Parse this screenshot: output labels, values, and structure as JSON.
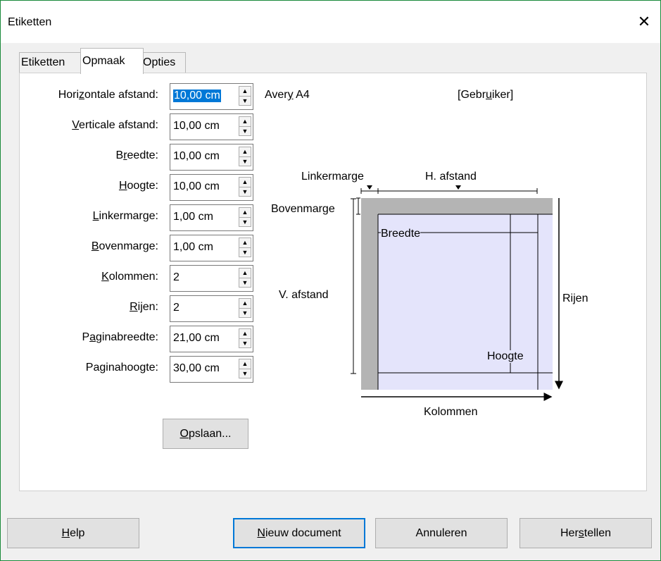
{
  "window": {
    "title": "Etiketten",
    "close_glyph": "✕"
  },
  "tabs": [
    "Etiketten",
    "Opmaak",
    "Opties"
  ],
  "fields": [
    {
      "pre": "Hori",
      "ul": "z",
      "post": "ontale afstand:",
      "value": "10,00 cm",
      "selected": true
    },
    {
      "pre": "",
      "ul": "V",
      "post": "erticale afstand:",
      "value": "10,00 cm"
    },
    {
      "pre": "B",
      "ul": "r",
      "post": "eedte:",
      "value": "10,00 cm"
    },
    {
      "pre": "",
      "ul": "H",
      "post": "oogte:",
      "value": "10,00 cm"
    },
    {
      "pre": "",
      "ul": "L",
      "post": "inkermarge:",
      "value": "1,00 cm"
    },
    {
      "pre": "",
      "ul": "B",
      "post": "ovenmarge:",
      "value": "1,00 cm"
    },
    {
      "pre": "",
      "ul": "K",
      "post": "olommen:",
      "value": "2"
    },
    {
      "pre": "",
      "ul": "R",
      "post": "ijen:",
      "value": "2"
    },
    {
      "pre": "P",
      "ul": "a",
      "post": "ginabreedte:",
      "value": "21,00 cm"
    },
    {
      "pre": "Pa",
      "ul": "g",
      "post": "inahoogte:",
      "value": "30,00 cm"
    }
  ],
  "save_button": {
    "pre": "",
    "ul": "O",
    "post": "pslaan..."
  },
  "brand": {
    "pre": "Aver",
    "ul": "y",
    "post": " A4"
  },
  "type": {
    "pre": "[Gebr",
    "ul": "u",
    "post": "iker]"
  },
  "diagram": {
    "linkermarge": "Linkermarge",
    "h_afstand": "H. afstand",
    "bovenmarge": "Bovenmarge",
    "breedte": "Breedte",
    "v_afstand": "V. afstand",
    "rijen": "Rijen",
    "hoogte": "Hoogte",
    "kolommen": "Kolommen"
  },
  "buttons": {
    "help": {
      "pre": "",
      "ul": "H",
      "post": "elp"
    },
    "new_doc": {
      "pre": "",
      "ul": "N",
      "post": "ieuw document"
    },
    "cancel": {
      "pre": "Annuleren",
      "ul": "",
      "post": ""
    },
    "reset": {
      "pre": "Her",
      "ul": "s",
      "post": "tellen"
    }
  },
  "colors": {
    "selection": "#0078d7",
    "label_fill": "#e4e4fb",
    "margin_fill": "#b4b4b4"
  }
}
